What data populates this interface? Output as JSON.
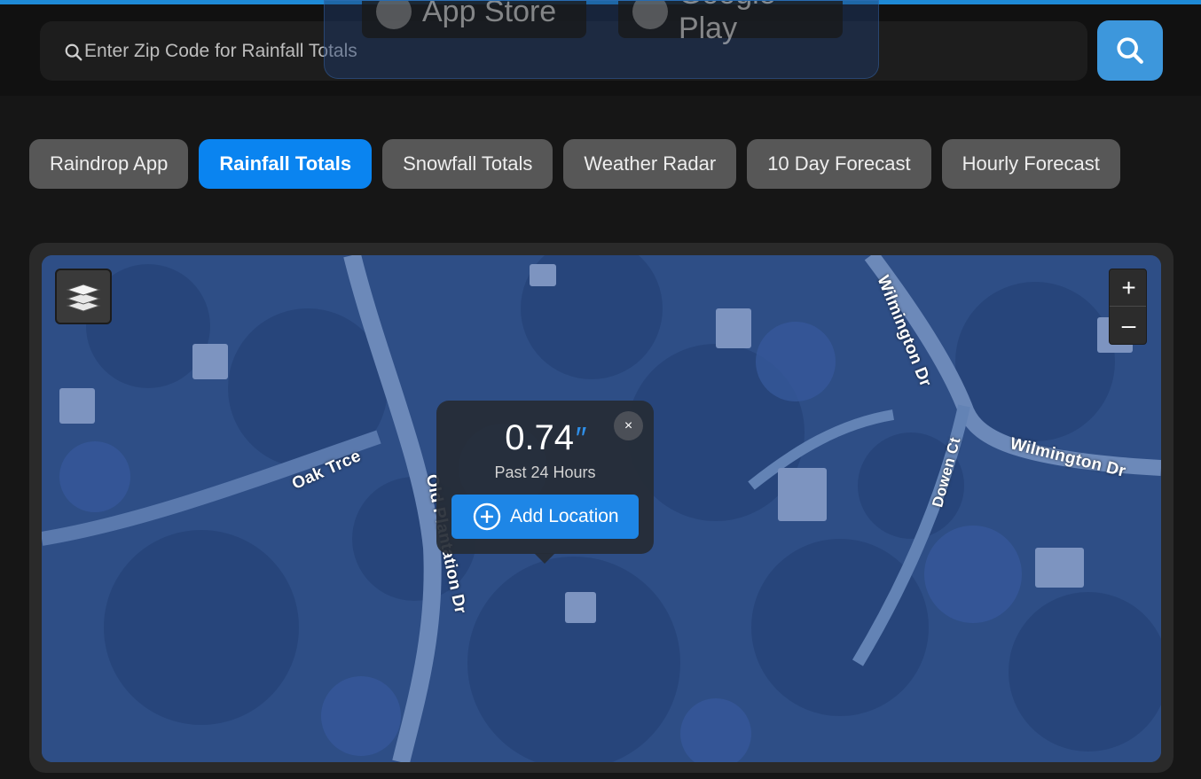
{
  "search": {
    "placeholder": "Enter Zip Code for Rainfall Totals"
  },
  "store_banner": {
    "app_store_label": "App Store",
    "google_play_label": "Google Play"
  },
  "tabs": [
    {
      "label": "Raindrop App",
      "active": false
    },
    {
      "label": "Rainfall Totals",
      "active": true
    },
    {
      "label": "Snowfall Totals",
      "active": false
    },
    {
      "label": "Weather Radar",
      "active": false
    },
    {
      "label": "10 Day Forecast",
      "active": false
    },
    {
      "label": "Hourly Forecast",
      "active": false
    }
  ],
  "map": {
    "zoom_in": "+",
    "zoom_out": "–",
    "streets": {
      "oak_trce": "Oak Trce",
      "old_plantation": "Old Plantation Dr",
      "wilmington_vertical": "Wilmington Dr",
      "wilmington_horizontal": "Wilmington Dr",
      "dowen_ct": "Dowen Ct"
    },
    "icons": {
      "layers": "layers-icon",
      "search": "search-icon"
    },
    "popup": {
      "value": "0.74",
      "unit": "″",
      "period": "Past 24 Hours",
      "close": "×",
      "add_location": "Add Location"
    }
  },
  "colors": {
    "accent": "#0a84f0",
    "search_button": "#3d97dc",
    "tab_inactive": "#575757",
    "background": "#161616"
  }
}
